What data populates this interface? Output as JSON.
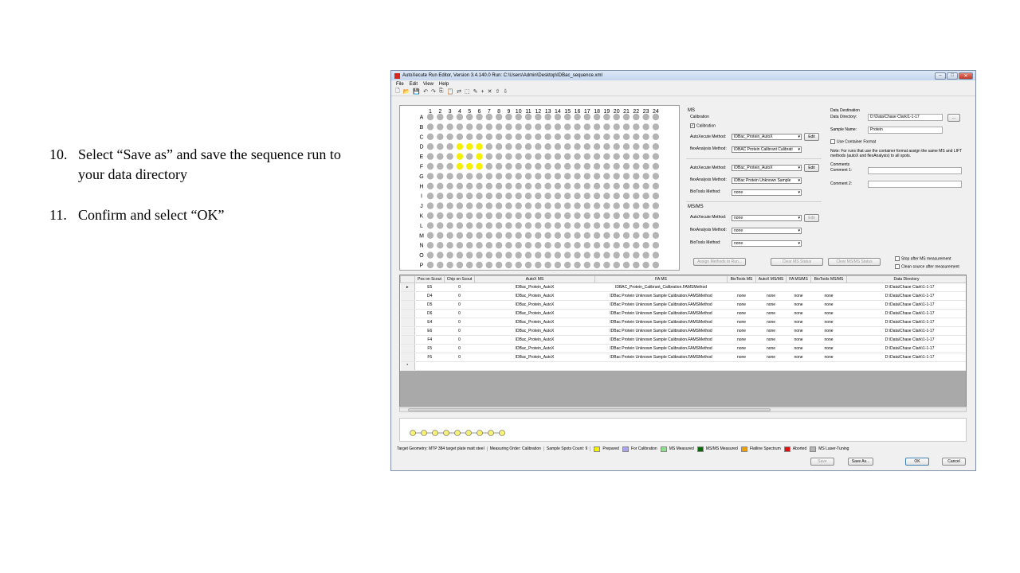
{
  "slide": {
    "steps": [
      {
        "num": "10.",
        "text": "Select “Save as” and save the sequence run to your data directory"
      },
      {
        "num": "11.",
        "text": "Confirm and select “OK”"
      }
    ]
  },
  "window": {
    "title": "AutoXecute Run Editor, Version 3.4.140.0  Run: C:\\Users\\Admin\\Desktop\\IDBac_sequence.xml",
    "menu": [
      "File",
      "Edit",
      "View",
      "Help"
    ]
  },
  "plate": {
    "columns": [
      "1",
      "2",
      "3",
      "4",
      "5",
      "6",
      "7",
      "8",
      "9",
      "10",
      "11",
      "12",
      "13",
      "14",
      "15",
      "16",
      "17",
      "18",
      "19",
      "20",
      "21",
      "22",
      "23",
      "24"
    ],
    "rows": [
      "A",
      "B",
      "C",
      "D",
      "E",
      "F",
      "G",
      "H",
      "I",
      "J",
      "K",
      "L",
      "M",
      "N",
      "O",
      "P"
    ],
    "selected": [
      "D4",
      "D5",
      "D6",
      "E4",
      "E6",
      "F4",
      "F5",
      "F6"
    ],
    "colors": {
      "spot": "#b4b4b4",
      "selected": "#f5f000"
    }
  },
  "ms": {
    "section": "MS",
    "calibration_group": "Calibration",
    "calibration_check": "Calibration",
    "autox_label": "AutoXecute Method:",
    "autox_value": "IDBac_Protein_AutoX",
    "flex_label": "flexAnalysis Method:",
    "flex_value": "IDBAC Protein Calibrant Calibrati",
    "edit": "Edit",
    "autox2_value": "IDBac_Protein_AutoX",
    "flex2_value": "IDBac Protein Unknown Sample",
    "biotools_label": "BioTools Method:",
    "biotools_value": "none"
  },
  "msms": {
    "section": "MS/MS",
    "autox_label": "AutoXecute Method:",
    "autox_value": "none",
    "flex_label": "flexAnalysis Method:",
    "flex_value": "none",
    "biotools_label": "BioTools Method:",
    "biotools_value": "none",
    "edit": "Edit"
  },
  "destination": {
    "title": "Data Destination",
    "dir_label": "Data Directory:",
    "dir_value": "D:\\Data\\Chase Clark\\1-1-17",
    "browse": "...",
    "sample_label": "Sample Name:",
    "sample_value": "Protein",
    "container": "Use Container Format",
    "note": "Note: For runs that use the container format assign the same MS and LIFT methods (autoX and flexAnalysis) to all spots.",
    "comments": "Comments",
    "comment1": "Comment 1:",
    "comment2": "Comment 2:"
  },
  "actions": {
    "assign": "Assign Methods to Run...",
    "clear_ms": "Clear MS Status",
    "clear_msms": "Clear MS/MS Status",
    "stop_after": "Stop after MS measurement",
    "clean_source": "Clean source after measurement"
  },
  "grid": {
    "headers": [
      "Pos on Scout",
      "Chip on Scout",
      "AutoX MS",
      "FA MS",
      "BioTools MS",
      "AutoX MS/MS",
      "FA MS/MS",
      "BioTools MS/MS",
      "Data Directory"
    ],
    "rows": [
      [
        "E5",
        "0",
        "IDBac_Protein_AutoX",
        "IDBAC_Protein_Calibrant_Calibration.FAMSMethod",
        "",
        "",
        "",
        "",
        "D:\\Data\\Chase Clark\\1-1-17"
      ],
      [
        "D4",
        "0",
        "IDBac_Protein_AutoX",
        "IDBac Protein Unknown Sample Calibration.FAMSMethod",
        "none",
        "none",
        "none",
        "none",
        "D:\\Data\\Chase Clark\\1-1-17"
      ],
      [
        "D5",
        "0",
        "IDBac_Protein_AutoX",
        "IDBac Protein Unknown Sample Calibration.FAMSMethod",
        "none",
        "none",
        "none",
        "none",
        "D:\\Data\\Chase Clark\\1-1-17"
      ],
      [
        "D6",
        "0",
        "IDBac_Protein_AutoX",
        "IDBac Protein Unknown Sample Calibration.FAMSMethod",
        "none",
        "none",
        "none",
        "none",
        "D:\\Data\\Chase Clark\\1-1-17"
      ],
      [
        "E4",
        "0",
        "IDBac_Protein_AutoX",
        "IDBac Protein Unknown Sample Calibration.FAMSMethod",
        "none",
        "none",
        "none",
        "none",
        "D:\\Data\\Chase Clark\\1-1-17"
      ],
      [
        "E6",
        "0",
        "IDBac_Protein_AutoX",
        "IDBac Protein Unknown Sample Calibration.FAMSMethod",
        "none",
        "none",
        "none",
        "none",
        "D:\\Data\\Chase Clark\\1-1-17"
      ],
      [
        "F4",
        "0",
        "IDBac_Protein_AutoX",
        "IDBac Protein Unknown Sample Calibration.FAMSMethod",
        "none",
        "none",
        "none",
        "none",
        "D:\\Data\\Chase Clark\\1-1-17"
      ],
      [
        "F5",
        "0",
        "IDBac_Protein_AutoX",
        "IDBac Protein Unknown Sample Calibration.FAMSMethod",
        "none",
        "none",
        "none",
        "none",
        "D:\\Data\\Chase Clark\\1-1-17"
      ],
      [
        "F6",
        "0",
        "IDBac_Protein_AutoX",
        "IDBac Protein Unknown Sample Calibration.FAMSMethod",
        "none",
        "none",
        "none",
        "none",
        "D:\\Data\\Chase Clark\\1-1-17"
      ]
    ],
    "new_row_marker": "*"
  },
  "status": {
    "geometry": "Target Geometry: MTP 384 target plate matt steel",
    "order": "Measuring Order: Calibration",
    "count": "Sample Spots Count: 9",
    "legend": [
      {
        "label": "Prepared",
        "color": "#f5f000"
      },
      {
        "label": "For Calibration",
        "color": "#a9a4f0"
      },
      {
        "label": "MS Measured",
        "color": "#8ee08e"
      },
      {
        "label": "MS/MS Measured",
        "color": "#0a6a0a"
      },
      {
        "label": "Flatline Spectrum",
        "color": "#f0a000"
      },
      {
        "label": "Aborted",
        "color": "#e01010"
      },
      {
        "label": "MS Laser-Tuning",
        "color": "#b4b4b4"
      }
    ]
  },
  "footer": {
    "save": "Save",
    "save_as": "Save As...",
    "ok": "OK",
    "cancel": "Cancel"
  }
}
